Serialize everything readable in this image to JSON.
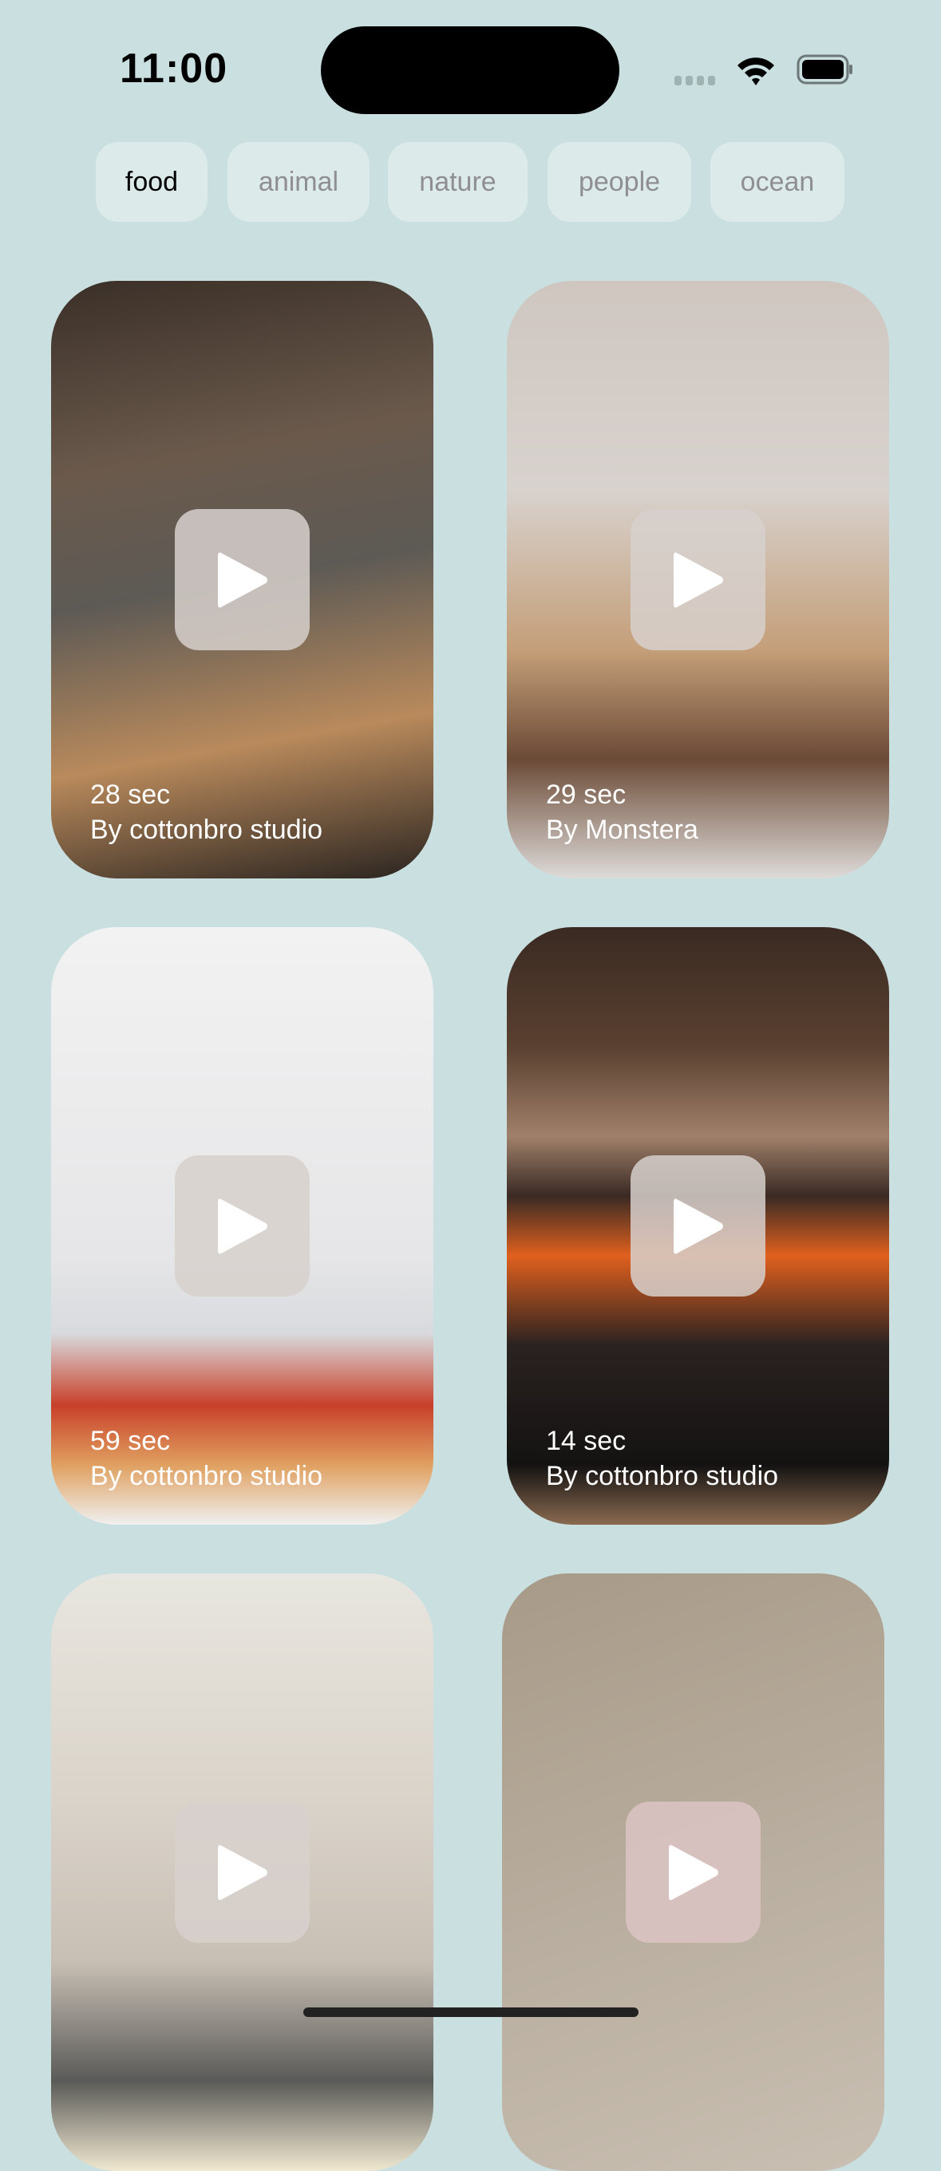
{
  "status_bar": {
    "time": "11:00"
  },
  "categories": [
    {
      "label": "food",
      "active": true
    },
    {
      "label": "animal",
      "active": false
    },
    {
      "label": "nature",
      "active": false
    },
    {
      "label": "people",
      "active": false
    },
    {
      "label": "ocean",
      "active": false
    }
  ],
  "videos": [
    {
      "duration": "28 sec",
      "author": "By cottonbro studio"
    },
    {
      "duration": "29 sec",
      "author": "By Monstera"
    },
    {
      "duration": "59 sec",
      "author": "By cottonbro studio"
    },
    {
      "duration": "14 sec",
      "author": "By cottonbro studio"
    },
    {
      "duration": "",
      "author": ""
    },
    {
      "duration": "",
      "author": ""
    }
  ],
  "colors": {
    "background": "#c9dfe0",
    "chip": "#ddeaea",
    "chip_text_inactive": "#8e8e93"
  }
}
